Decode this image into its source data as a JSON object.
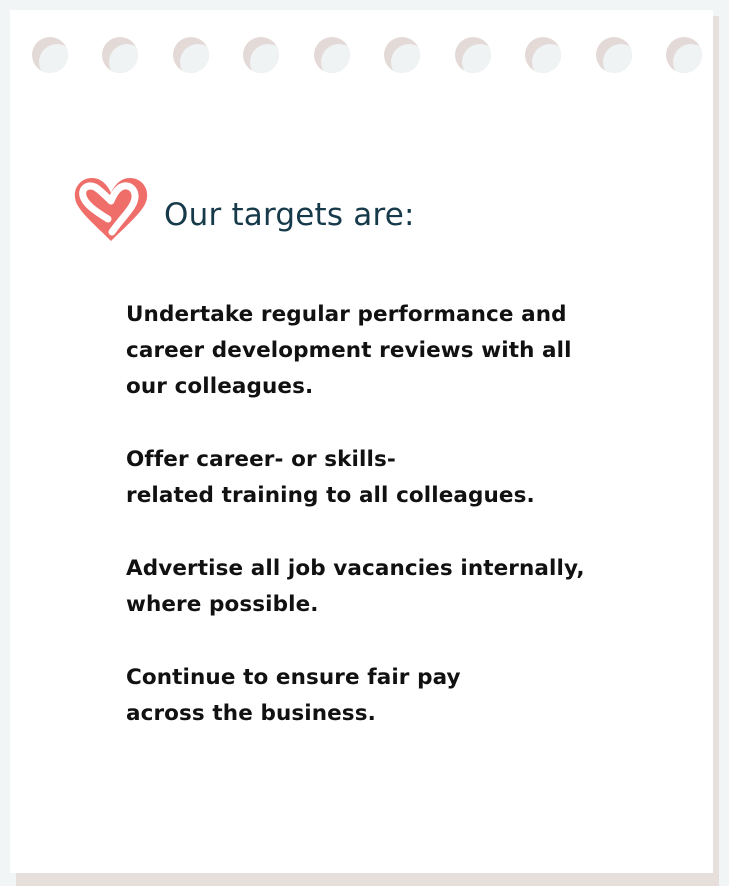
{
  "page": {
    "title": "Our targets are:",
    "accent_color": "#ef6e6a",
    "title_color": "#173a4b",
    "heading_icon": "heart-icon",
    "binder_holes": 10
  },
  "targets": [
    {
      "lines": [
        "Undertake regular performance and",
        "career development reviews with all",
        "our colleagues."
      ]
    },
    {
      "lines": [
        "Offer career- or skills-",
        "related training to all colleagues."
      ]
    },
    {
      "lines": [
        "Advertise all job vacancies internally,",
        "where possible."
      ]
    },
    {
      "lines": [
        "Continue to ensure fair pay",
        "across the business."
      ]
    }
  ]
}
